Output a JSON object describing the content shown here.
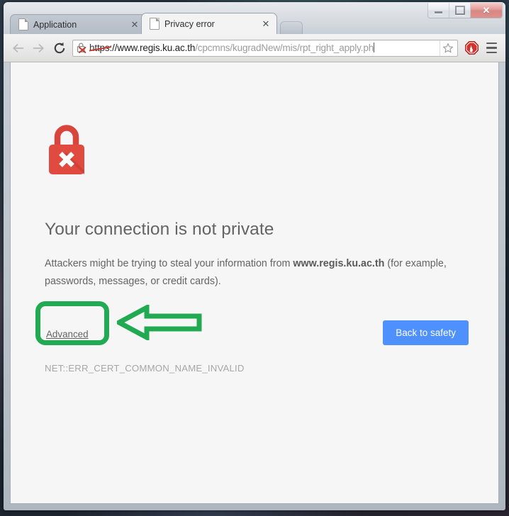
{
  "window": {
    "controls": {
      "minimize": "minimize-button",
      "maximize": "maximize-button",
      "close_label": "✕"
    }
  },
  "tabs": [
    {
      "title": "Application",
      "active": false,
      "close_label": "✕"
    },
    {
      "title": "Privacy error",
      "active": true,
      "close_label": "✕"
    }
  ],
  "toolbar": {
    "back_icon": "back-arrow-icon",
    "forward_icon": "forward-arrow-icon",
    "reload_icon": "reload-icon",
    "security_icon": "broken-lock-icon",
    "star_icon": "bookmark-star-icon",
    "adblock_icon": "adblock-stop-hand-icon",
    "menu_icon": "hamburger-menu-icon",
    "url": {
      "scheme": "https",
      "separator": "://",
      "host": "www.regis.ku.ac.th",
      "path": "/cpcmns/kugradNew/mis/rpt_right_apply.ph",
      "full": "https://www.regis.ku.ac.th/cpcmns/kugradNew/mis/rpt_right_apply.php"
    }
  },
  "interstitial": {
    "icon": "red-padlock-error-icon",
    "title": "Your connection is not private",
    "body_part1": "Attackers might be trying to steal your information from ",
    "body_host": "www.regis.ku.ac.th",
    "body_part2": " (for example, passwords, messages, or credit cards).",
    "advanced_label": "Advanced",
    "back_to_safety_label": "Back to safety",
    "error_code": "NET::ERR_CERT_COMMON_NAME_INVALID"
  },
  "annotations": {
    "highlight_box": "green-rounded-rectangle-around-advanced",
    "arrow": "green-left-pointing-arrow",
    "color": "#22aa52"
  },
  "colors": {
    "primary_button": "#4d90fe",
    "error_red": "#d93025",
    "text_gray": "#646464",
    "page_background": "#f6f6f6",
    "annotation_green": "#22aa52"
  }
}
